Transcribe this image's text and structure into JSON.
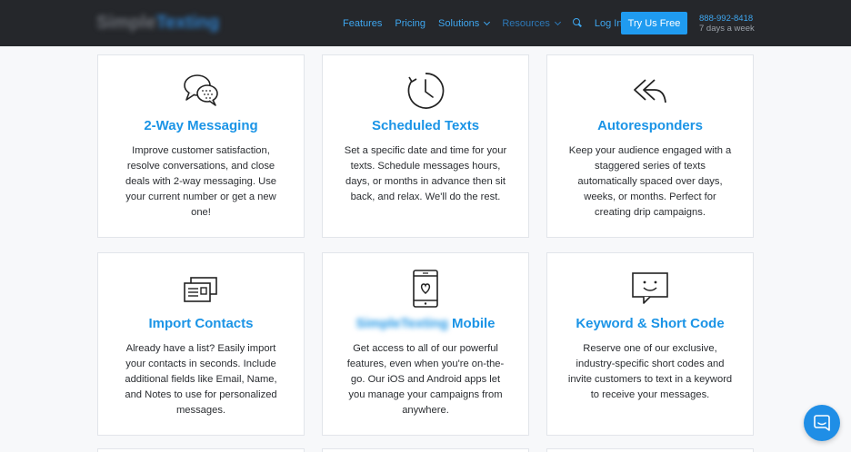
{
  "header": {
    "logo_main": "Simple",
    "logo_accent": "Texting",
    "nav": [
      {
        "label": "Features"
      },
      {
        "label": "Pricing"
      },
      {
        "label": "Solutions"
      },
      {
        "label": "Resources"
      }
    ],
    "login_label": "Log In",
    "cta_label": "Try Us Free",
    "phone": "888-992-8418",
    "hours": "7 days a week"
  },
  "cards": [
    {
      "title": "2-Way Messaging",
      "desc": "Improve customer satisfaction, resolve conversations, and close deals with 2-way messaging. Use your current number or get a new one!",
      "icon": "chat-bubbles-icon"
    },
    {
      "title": "Scheduled Texts",
      "desc": "Set a specific date and time for your texts. Schedule messages hours, days, or months in advance then sit back, and relax. We'll do the rest.",
      "icon": "clock-icon"
    },
    {
      "title": "Autoresponders",
      "desc": "Keep your audience engaged with a staggered series of texts automatically spaced over days, weeks, or months. Perfect for creating drip campaigns.",
      "icon": "reply-all-icon"
    },
    {
      "title": "Import Contacts",
      "desc": "Already have a list? Easily import your contacts in seconds. Include additional fields like Email, Name, and Notes to use for personalized messages.",
      "icon": "contact-cards-icon"
    },
    {
      "title_blurred": "SimpleTexting",
      "title": "Mobile",
      "desc": "Get access to all of our powerful features, even when you're on-the-go. Our iOS and Android apps let you manage your campaigns from anywhere.",
      "icon": "phone-heart-icon"
    },
    {
      "title": "Keyword & Short Code",
      "desc": "Reserve one of our exclusive, industry-specific short codes and invite customers to text in a keyword to receive your messages.",
      "icon": "smile-message-icon"
    }
  ],
  "colors": {
    "accent": "#1b94e6",
    "topbar": "#25272b",
    "cta": "#1f9bf0"
  }
}
